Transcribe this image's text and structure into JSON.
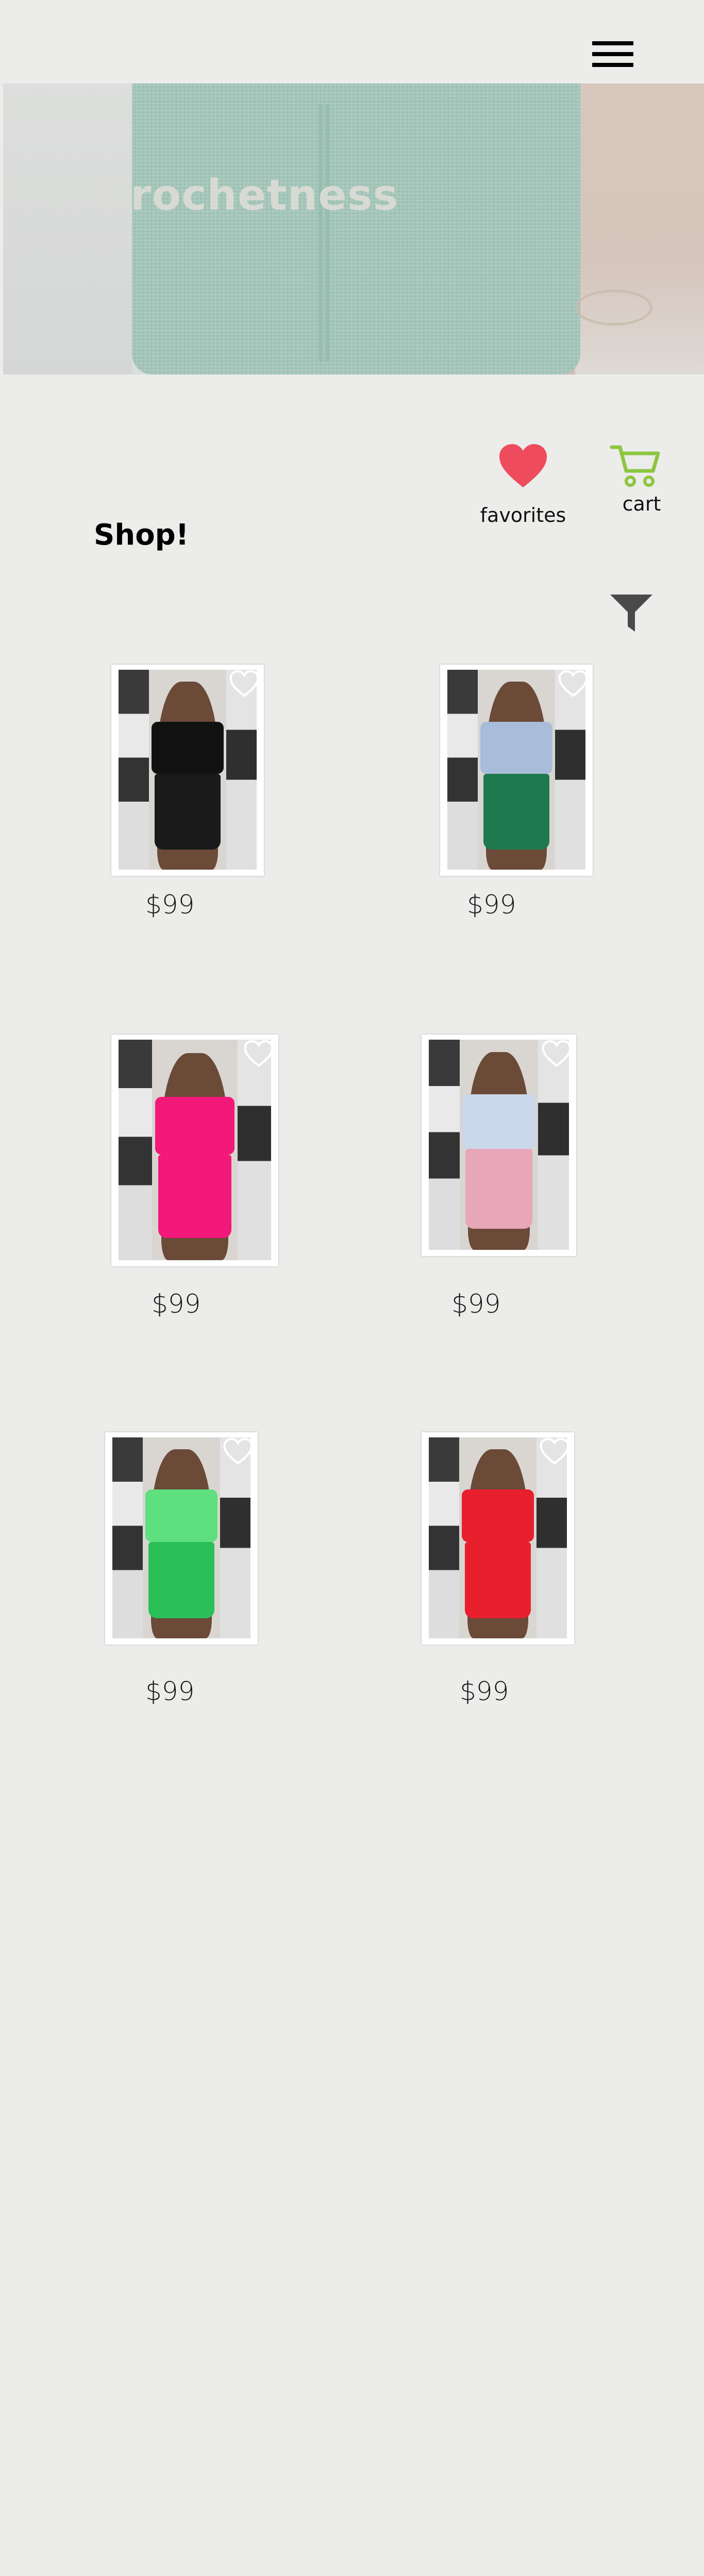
{
  "header": {
    "menu_icon": "hamburger-menu-icon"
  },
  "hero": {
    "title": "Crochetness"
  },
  "actions": {
    "favorites_label": "favorites",
    "favorites_icon": "heart-icon",
    "favorites_color": "#ee4b5d",
    "cart_label": "cart",
    "cart_icon": "cart-icon",
    "cart_color": "#8cc63f"
  },
  "shop": {
    "title": "Shop!",
    "filter_icon": "filter-funnel-icon",
    "products": [
      {
        "price": "$99",
        "top_color": "#111111",
        "bottom_color": "#1a1a1a",
        "favorite_icon": "heart-outline-icon"
      },
      {
        "price": "$99",
        "top_color": "#a9bcd9",
        "bottom_color": "#1e7a4e",
        "favorite_icon": "heart-outline-icon"
      },
      {
        "price": "$99",
        "top_color": "#f2197a",
        "bottom_color": "#f2197a",
        "favorite_icon": "heart-outline-icon"
      },
      {
        "price": "$99",
        "top_color": "#c9d8ea",
        "bottom_color": "#e7a7b8",
        "favorite_icon": "heart-outline-icon"
      },
      {
        "price": "$99",
        "top_color": "#5ee07e",
        "bottom_color": "#2bbf58",
        "favorite_icon": "heart-outline-icon"
      },
      {
        "price": "$99",
        "top_color": "#e8202e",
        "bottom_color": "#e8202e",
        "favorite_icon": "heart-outline-icon"
      }
    ]
  }
}
